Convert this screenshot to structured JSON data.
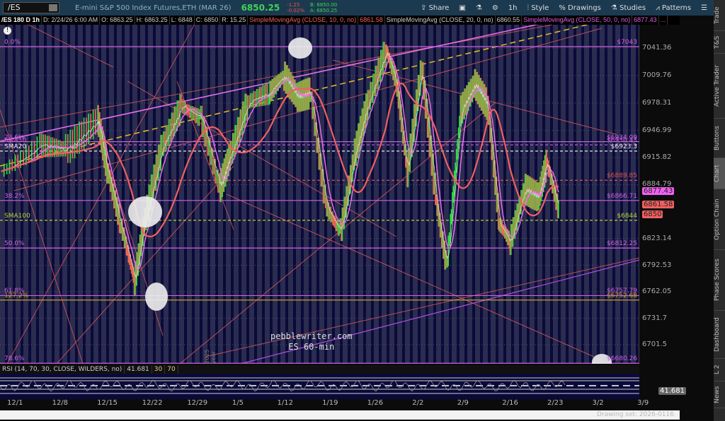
{
  "header": {
    "symbol": "/ES",
    "description": "E-mini S&P 500 Index Futures,ETH (MAR 26)",
    "last": "6850.25",
    "change": "-1.25",
    "change_pct": "-0.02%",
    "bid": "B: 6850.00",
    "ask": "A: 6850.25"
  },
  "toolbar": {
    "share": "Share",
    "timeframe": "1h",
    "style": "Style",
    "drawings": "Drawings",
    "studies": "Studies",
    "patterns": "Patterns"
  },
  "info": {
    "chart": "/ES 180 D 1h",
    "date": "D: 2/24/26 6:00 AM",
    "open": "O: 6863.25",
    "high": "H: 6863.25",
    "low": "L: 6848",
    "close": "C: 6850",
    "range": "R: 15.25",
    "sma10": "SimpleMovingAvg (CLOSE, 10, 0, no)",
    "sma10_val": "6861.58",
    "sma20": "SimpleMovingAvg (CLOSE, 20, 0, no)",
    "sma20_val": "6860.55",
    "sma50": "SimpleMovingAvg (CLOSE, 50, 0, no)",
    "sma50_val": "6877.43",
    "more": "..."
  },
  "side_tabs": [
    "Trade",
    "T&S",
    "Active Trader",
    "Buttons",
    "Chart",
    "Option Chain",
    "Phase Scores",
    "Dashboard",
    "L 2",
    "News"
  ],
  "price_ticks": [
    "7041.36",
    "7009.76",
    "6978.31",
    "6946.99",
    "6915.82",
    "6884.79",
    "6823.14",
    "6792.53",
    "6762.05",
    "6731.7",
    "6701.5"
  ],
  "badges": [
    {
      "text": "6877.43",
      "price": 6877.43,
      "color": "#f060f0"
    },
    {
      "text": "6861.58",
      "price": 6861.58,
      "color": "#f06060"
    },
    {
      "text": "6850",
      "price": 6850,
      "color": "#f06060"
    }
  ],
  "levels": [
    {
      "price": 7043,
      "left": "0.0%",
      "right": "$7043",
      "color": "#d060e0",
      "dash": false
    },
    {
      "price": 6934.09,
      "left": "23.6%",
      "right": "$6934.09",
      "color": "#d060e0",
      "dash": false
    },
    {
      "price": 6930.43,
      "left": "SMA50",
      "right": "$6930.43",
      "color": "#d060e0",
      "dash": true
    },
    {
      "price": 6923.3,
      "left": "SMA20",
      "right": "$6923.3",
      "color": "#e8e8e8",
      "dash": true
    },
    {
      "price": 6889.85,
      "left": "",
      "right": "$6889.85",
      "color": "#e05050",
      "dash": true
    },
    {
      "price": 6866.71,
      "left": "38.2%",
      "right": "$6866.71",
      "color": "#d060e0",
      "dash": false
    },
    {
      "price": 6844,
      "left": "SMA100",
      "right": "$6844",
      "color": "#b8d030",
      "dash": true
    },
    {
      "price": 6812.25,
      "left": "50.0%",
      "right": "$6812.25",
      "color": "#d060e0",
      "dash": false
    },
    {
      "price": 6757.79,
      "left": "61.8%",
      "right": "$6757.79",
      "color": "#d060e0",
      "dash": false
    },
    {
      "price": 6752.68,
      "left": "127.2%",
      "right": "$6752.68",
      "color": "#c8a020",
      "dash": false
    },
    {
      "price": 6680.26,
      "left": "78.6%",
      "right": "$6680.26",
      "color": "#d060e0",
      "dash": false
    }
  ],
  "watermark": {
    "line1": "pebblewriter.com",
    "line2": "ES 60-min"
  },
  "year_marker": "2025 year",
  "rsi": {
    "label": "RSI (14, 70, 30, CLOSE, WILDERS, no)",
    "value": "41.681",
    "low": "30",
    "high": "70"
  },
  "date_ticks": [
    {
      "label": "12/1",
      "day": 0
    },
    {
      "label": "12/8",
      "day": 7
    },
    {
      "label": "12/15",
      "day": 14
    },
    {
      "label": "12/22",
      "day": 21
    },
    {
      "label": "12/29",
      "day": 28
    },
    {
      "label": "1/5",
      "day": 35
    },
    {
      "label": "1/12",
      "day": 42
    },
    {
      "label": "1/19",
      "day": 49
    },
    {
      "label": "1/26",
      "day": 56
    },
    {
      "label": "2/2",
      "day": 63
    },
    {
      "label": "2/9",
      "day": 70
    },
    {
      "label": "2/16",
      "day": 77
    },
    {
      "label": "2/23",
      "day": 84
    },
    {
      "label": "3/2",
      "day": 91
    },
    {
      "label": "3/9",
      "day": 98
    }
  ],
  "drawing_set": "Drawing set: 2026-0116",
  "chart_data": {
    "type": "line",
    "title": "/ES 180 D 1h",
    "ylim": [
      6660,
      7065
    ],
    "days": [
      -2,
      4,
      8,
      13,
      14.5,
      16.5,
      18.7,
      20.4,
      23,
      26,
      29,
      31.9,
      33.6,
      36.3,
      39.6,
      41.9,
      44,
      46,
      48.4,
      50.7,
      52.9,
      55,
      57.8,
      59.5,
      61.1,
      63.3,
      65.5,
      67.2,
      69.4,
      71.6,
      73.6,
      75.4,
      77.1,
      79.3,
      81.5,
      82.8,
      84.8
    ],
    "close": [
      6900,
      6930,
      6925,
      6960,
      6900,
      6840,
      6775,
      6850,
      6930,
      6975,
      6960,
      6880,
      6920,
      6980,
      6990,
      7010,
      6985,
      6990,
      6860,
      6830,
      6920,
      6980,
      7040,
      7000,
      6900,
      7020,
      6870,
      6790,
      6970,
      7000,
      6975,
      6840,
      6820,
      6880,
      6870,
      6910,
      6850
    ]
  }
}
